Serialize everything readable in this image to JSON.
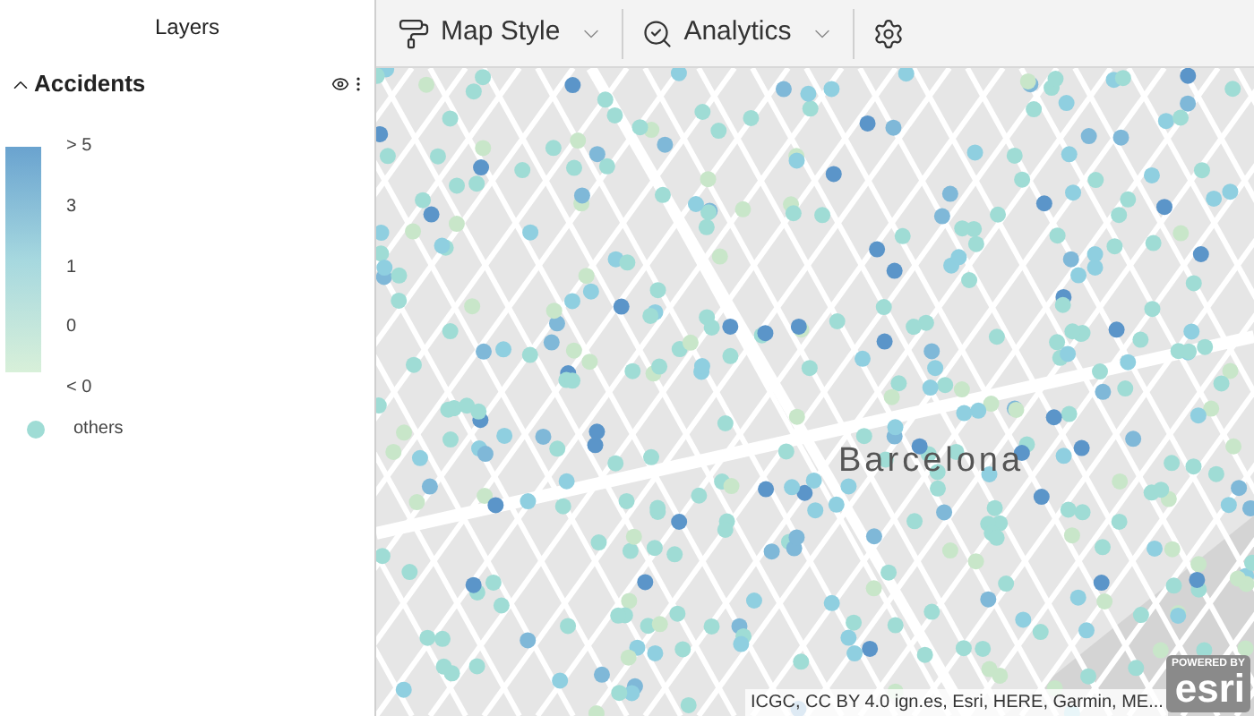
{
  "sidebar": {
    "title": "Layers",
    "layer": {
      "name": "Accidents",
      "expanded": true,
      "legend": {
        "labels": [
          "> 5",
          "3",
          "1",
          "0",
          "< 0"
        ],
        "others": {
          "label": "others",
          "color": "#9fdcd5"
        }
      }
    }
  },
  "toolbar": {
    "items": [
      {
        "kind": "menu",
        "label": "Map Style"
      },
      {
        "kind": "menu",
        "label": "Analytics"
      },
      {
        "kind": "settings"
      }
    ]
  },
  "map": {
    "place_label": "Barcelona",
    "attribution": "ICGC, CC BY 4.0 ign.es, Esri, HERE, Garmin, ME...",
    "logo_caption": "POWERED BY",
    "logo": "esri"
  }
}
